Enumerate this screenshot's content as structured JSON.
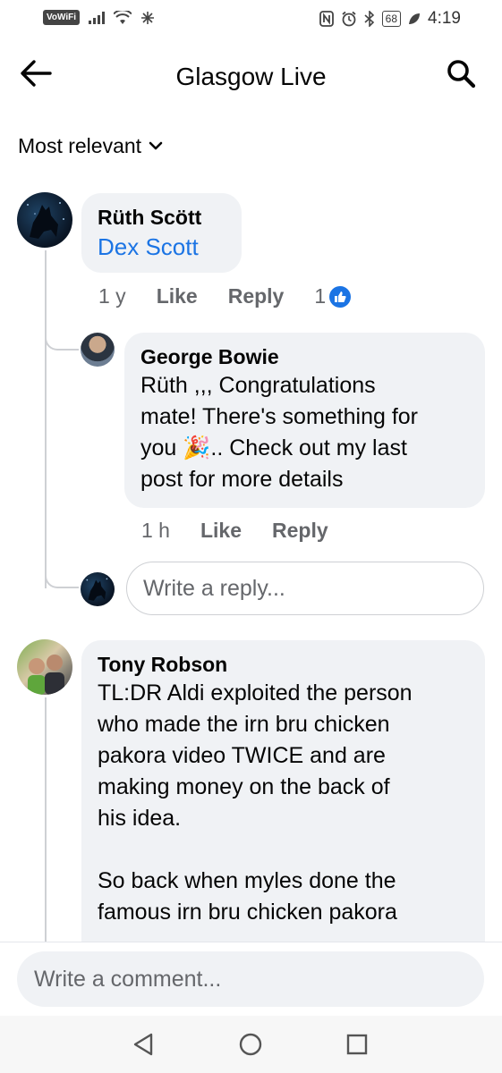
{
  "status_bar": {
    "left_badge": "VoWiFi",
    "battery": "68",
    "time": "4:19"
  },
  "header": {
    "title": "Glasgow Live",
    "back_icon": "back-arrow-icon",
    "search_icon": "search-icon"
  },
  "sort": {
    "label": "Most relevant",
    "icon": "chevron-down-icon"
  },
  "comments": [
    {
      "author": "Rüth Scött",
      "tag": "Dex Scott",
      "time": "1 y",
      "like_label": "Like",
      "reply_label": "Reply",
      "reaction_count": "1",
      "replies": [
        {
          "author": "George Bowie",
          "text_before_emoji": "Rüth ,,, Congratulations\nmate! There's something for\nyou ",
          "emoji": "🎉",
          "text_after_emoji": ".. Check out my last\npost for more details",
          "time": "1 h",
          "like_label": "Like",
          "reply_label": "Reply"
        }
      ],
      "reply_input_placeholder": "Write a reply..."
    },
    {
      "author": "Tony Robson",
      "text": "TL:DR Aldi exploited the person\nwho made the irn bru chicken\npakora video TWICE and are\nmaking money on the back of\nhis idea.\n\nSo back when myles done the\nfamous irn bru chicken pakora"
    }
  ],
  "composer": {
    "placeholder": "Write a comment..."
  },
  "nav_bar": {
    "back_icon": "nav-back-icon",
    "home_icon": "nav-home-icon",
    "recents_icon": "nav-recents-icon"
  },
  "colors": {
    "link": "#1b74e4",
    "bubble": "#f0f2f5",
    "secondary_text": "#65676b"
  }
}
